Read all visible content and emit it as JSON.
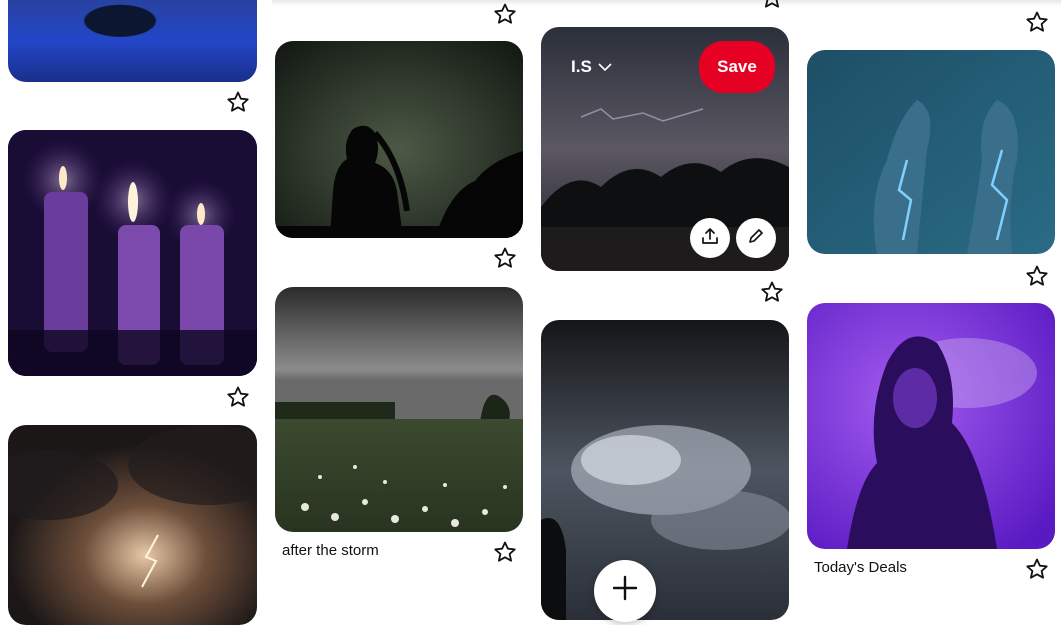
{
  "pins": {
    "after_storm_title": "after the storm",
    "todays_deals_title": "Today's Deals"
  },
  "hover_pin": {
    "board_name": "I.S",
    "save_label": "Save"
  },
  "icons": {
    "star": "star-outline-icon",
    "chevron": "chevron-down-icon",
    "share": "share-upload-icon",
    "edit": "pencil-icon",
    "add": "plus-icon"
  },
  "colors": {
    "save_red": "#e60023",
    "background": "#ffffff"
  }
}
